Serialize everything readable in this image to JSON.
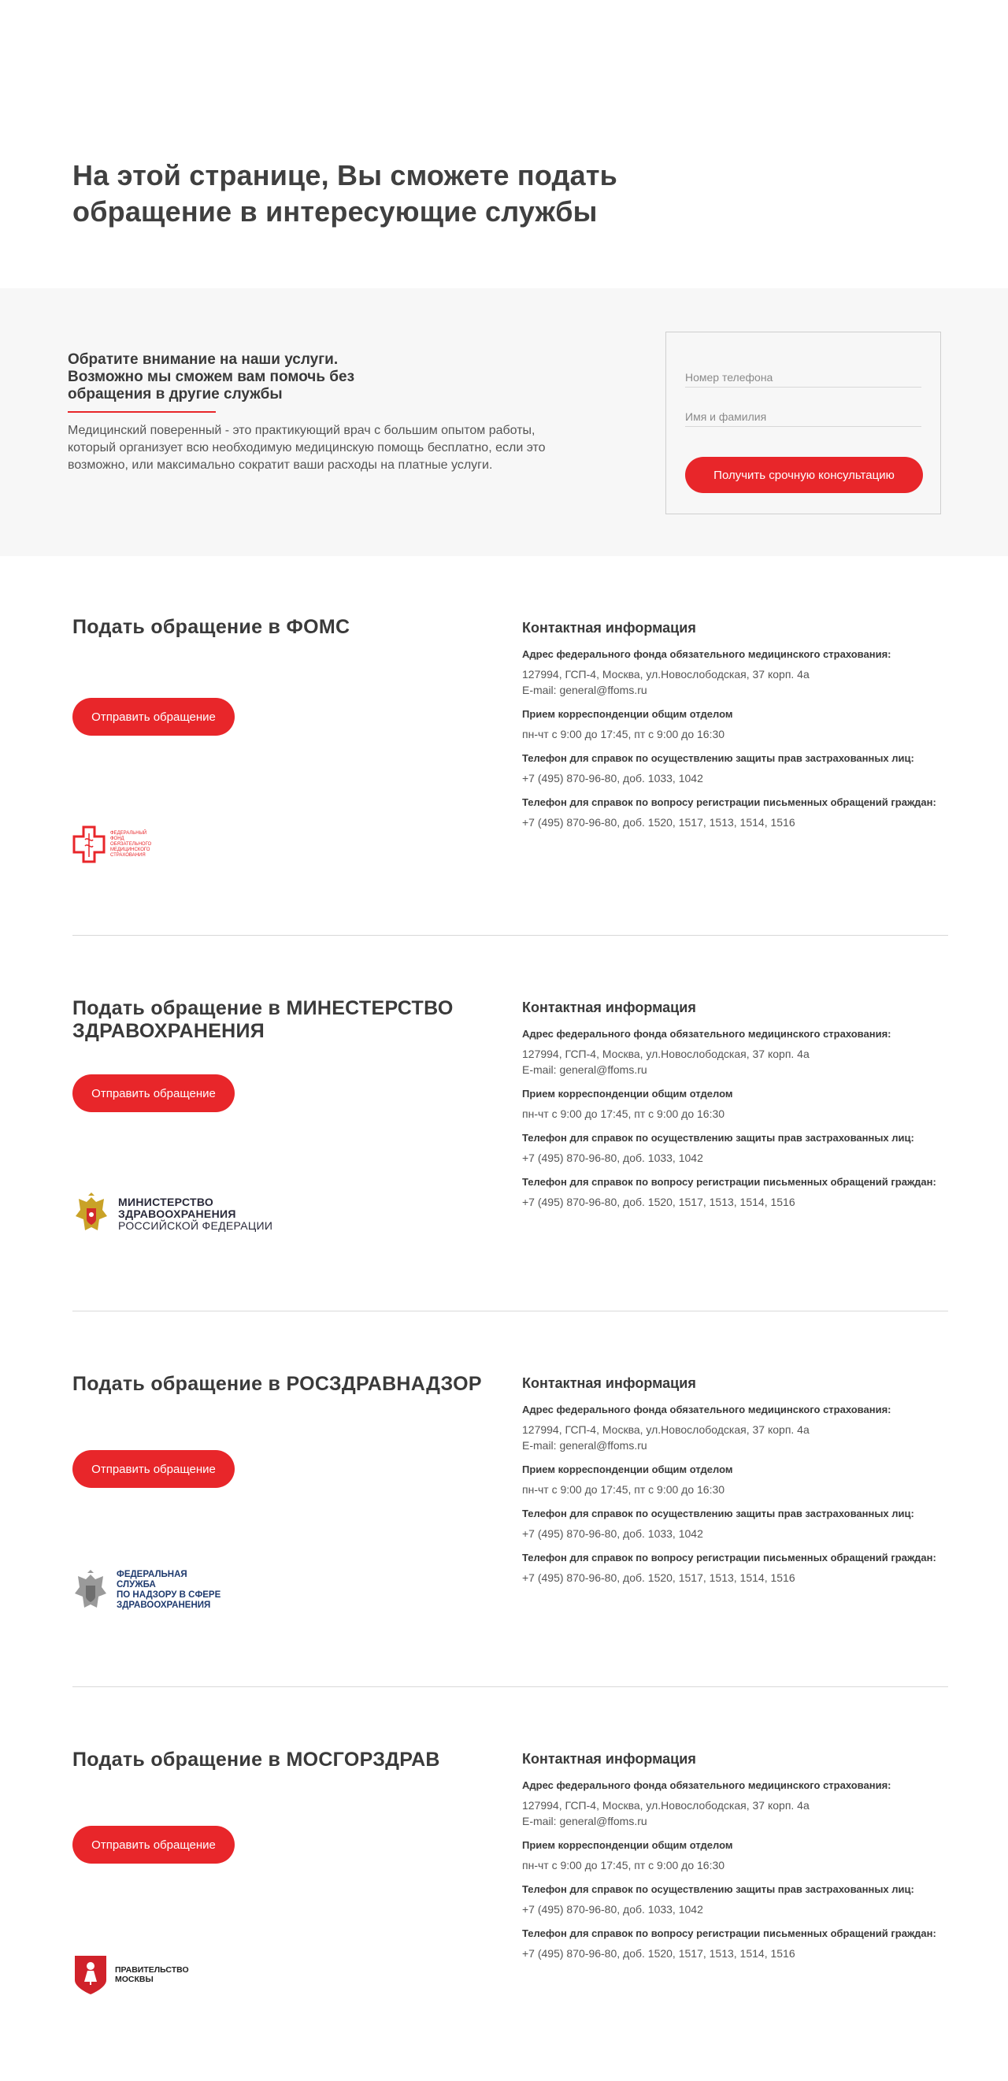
{
  "hero": {
    "title": "На этой странице, Вы сможете подать обращение в интересующие службы"
  },
  "promo": {
    "title": "Обратите внимание на наши услуги. Возможно мы сможем вам помочь без обращения в другие службы",
    "text": "Медицинский поверенный - это практикующий врач с большим опытом работы, который организует всю необходимую медицинскую помощь бесплатно, если это возможно, или максимально сократит ваши расходы на платные услуги.",
    "form": {
      "phone_placeholder": "Номер телефона",
      "name_placeholder": "Имя и фамилия",
      "submit_label": "Получить срочную консультацию"
    }
  },
  "colors": {
    "accent": "#e8262a",
    "band": "#f7f7f7",
    "text": "#3a3a3a"
  },
  "services": [
    {
      "title": "Подать обращение в ФОМС",
      "button": "Отправить обращение",
      "logo": {
        "icon": "foms-cross-icon",
        "text": "ФЕДЕРАЛЬНЫЙ ФОНД ОБЯЗАТЕЛЬНОГО МЕДИЦИНСКОГО СТРАХОВАНИЯ"
      },
      "contacts": {
        "title": "Контактная информация",
        "address_label": "Адрес федерального фонда обязательного медицинского страхования:",
        "address_line": "127994, ГСП-4, Москва, ул.Новослободская, 37 корп. 4а",
        "email_line": "E-mail: general@ffoms.ru",
        "hours_label": "Прием корреспонденции общим отделом",
        "hours_value": "пн-чт с 9:00 до 17:45, пт с 9:00 до 16:30",
        "phone1_label": "Телефон для справок по осуществлению защиты прав застрахованных лиц:",
        "phone1_value": "+7 (495) 870-96-80, доб. 1033, 1042",
        "phone2_label": "Телефон для справок по вопросу регистрации письменных обращений граждан:",
        "phone2_value": "+7 (495) 870-96-80, доб. 1520, 1517, 1513, 1514, 1516"
      }
    },
    {
      "title": "Подать обращение в МИНЕСТЕРСТВО ЗДРАВОХРАНЕНИЯ",
      "button": "Отправить обращение",
      "logo": {
        "icon": "coat-of-arms-icon",
        "line1": "МИНИСТЕРСТВО",
        "line2": "ЗДРАВООХРАНЕНИЯ",
        "line3": "РОССИЙСКОЙ ФЕДЕРАЦИИ"
      },
      "contacts": {
        "title": "Контактная информация",
        "address_label": "Адрес федерального фонда обязательного медицинского страхования:",
        "address_line": "127994, ГСП-4, Москва, ул.Новослободская, 37 корп. 4а",
        "email_line": "E-mail: general@ffoms.ru",
        "hours_label": "Прием корреспонденции общим отделом",
        "hours_value": "пн-чт с 9:00 до 17:45, пт с 9:00 до 16:30",
        "phone1_label": "Телефон для справок по осуществлению защиты прав застрахованных лиц:",
        "phone1_value": "+7 (495) 870-96-80, доб. 1033, 1042",
        "phone2_label": "Телефон для справок по вопросу регистрации письменных обращений граждан:",
        "phone2_value": "+7 (495) 870-96-80, доб. 1520, 1517, 1513, 1514, 1516"
      }
    },
    {
      "title": "Подать обращение в РОСЗДРАВНАДЗОР",
      "button": "Отправить обращение",
      "logo": {
        "icon": "grey-coat-of-arms-icon",
        "line1": "ФЕДЕРАЛЬНАЯ СЛУЖБА",
        "line2": "ПО НАДЗОРУ В СФЕРЕ",
        "line3": "ЗДРАВООХРАНЕНИЯ"
      },
      "contacts": {
        "title": "Контактная информация",
        "address_label": "Адрес федерального фонда обязательного медицинского страхования:",
        "address_line": "127994, ГСП-4, Москва, ул.Новослободская, 37 корп. 4а",
        "email_line": "E-mail: general@ffoms.ru",
        "hours_label": "Прием корреспонденции общим отделом",
        "hours_value": "пн-чт с 9:00 до 17:45, пт с 9:00 до 16:30",
        "phone1_label": "Телефон для справок по осуществлению защиты прав застрахованных лиц:",
        "phone1_value": "+7 (495) 870-96-80, доб. 1033, 1042",
        "phone2_label": "Телефон для справок по вопросу регистрации письменных обращений граждан:",
        "phone2_value": "+7 (495) 870-96-80, доб. 1520, 1517, 1513, 1514, 1516"
      }
    },
    {
      "title": "Подать обращение в МОСГОРЗДРАВ",
      "button": "Отправить обращение",
      "logo": {
        "icon": "moscow-emblem-icon",
        "line1": "ПРАВИТЕЛЬСТВО",
        "line2": "МОСКВЫ"
      },
      "contacts": {
        "title": "Контактная информация",
        "address_label": "Адрес федерального фонда обязательного медицинского страхования:",
        "address_line": "127994, ГСП-4, Москва, ул.Новослободская, 37 корп. 4а",
        "email_line": "E-mail: general@ffoms.ru",
        "hours_label": "Прием корреспонденции общим отделом",
        "hours_value": "пн-чт с 9:00 до 17:45, пт с 9:00 до 16:30",
        "phone1_label": "Телефон для справок по осуществлению защиты прав застрахованных лиц:",
        "phone1_value": "+7 (495) 870-96-80, доб. 1033, 1042",
        "phone2_label": "Телефон для справок по вопросу регистрации письменных обращений граждан:",
        "phone2_value": "+7 (495) 870-96-80, доб. 1520, 1517, 1513, 1514, 1516"
      }
    }
  ]
}
